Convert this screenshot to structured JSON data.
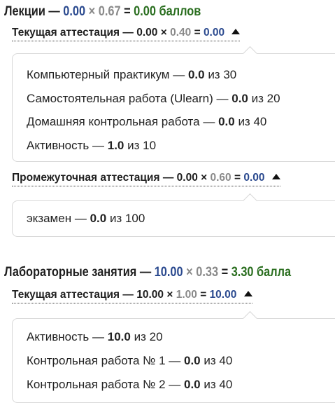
{
  "sections": [
    {
      "name": "Лекции",
      "value": "0.00",
      "weight": "0.67",
      "result": "0.00",
      "unit": "баллов",
      "attestations": [
        {
          "name": "Текущая аттестация",
          "value": "0.00",
          "weight": "0.40",
          "result": "0.00",
          "items": [
            {
              "name": "Компьютерный практикум",
              "score": "0.0",
              "of_word": "из",
              "max": "30"
            },
            {
              "name": "Самостоятельная работа (Ulearn)",
              "score": "0.0",
              "of_word": "из",
              "max": "20"
            },
            {
              "name": "Домашняя контрольная работа",
              "score": "0.0",
              "of_word": "из",
              "max": "40"
            },
            {
              "name": "Активность",
              "score": "1.0",
              "of_word": "из",
              "max": "10"
            }
          ]
        },
        {
          "name": "Промежуточная аттестация",
          "value": "0.00",
          "weight": "0.60",
          "result": "0.00",
          "items": [
            {
              "name": "экзамен",
              "score": "0.0",
              "of_word": "из",
              "max": "100"
            }
          ]
        }
      ]
    },
    {
      "name": "Лабораторные занятия",
      "value": "10.00",
      "weight": "0.33",
      "result": "3.30",
      "unit": "балла",
      "attestations": [
        {
          "name": "Текущая аттестация",
          "value": "10.00",
          "weight": "1.00",
          "result": "10.00",
          "items": [
            {
              "name": "Активность",
              "score": "10.0",
              "of_word": "из",
              "max": "20"
            },
            {
              "name": "Контрольная работа № 1",
              "score": "0.0",
              "of_word": "из",
              "max": "40"
            },
            {
              "name": "Контрольная работа № 2",
              "score": "0.0",
              "of_word": "из",
              "max": "40"
            }
          ]
        }
      ]
    }
  ],
  "symbols": {
    "dash": "—",
    "times": "×",
    "equals": "="
  },
  "colors": {
    "value": "#2b4a8f",
    "weight": "#8a8a8a",
    "result": "#2a6e1f",
    "box_border": "#d8d8d8"
  },
  "icons": {
    "collapse": "triangle-up-icon"
  }
}
